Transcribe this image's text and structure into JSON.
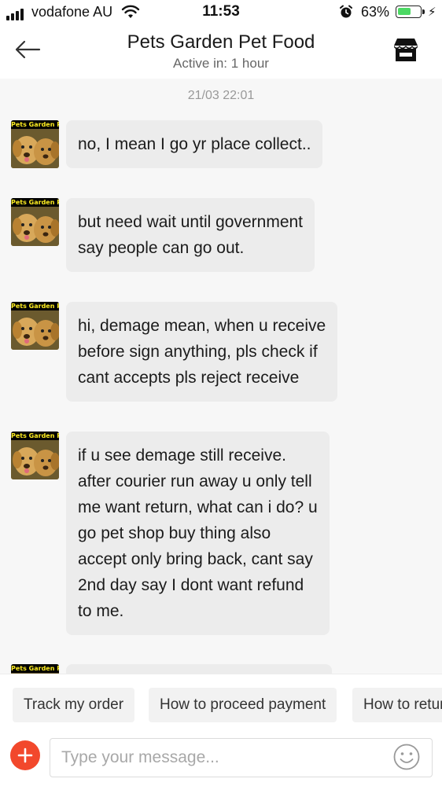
{
  "status_bar": {
    "carrier": "vodafone AU",
    "time": "11:53",
    "battery_percent": "63%",
    "battery_level": 0.63,
    "battery_color": "#4cd964"
  },
  "header": {
    "back_icon": "arrow-left-icon",
    "shop_name": "Pets Garden Pet Food",
    "active_status": "Active in: 1 hour",
    "store_icon": "store-icon"
  },
  "chat": {
    "timestamp": "21/03 22:01",
    "avatar_label": "Pets Garden Pet Food",
    "messages": [
      {
        "text": "no, I mean I go yr place collect.."
      },
      {
        "text": "but need wait until government\nsay people can go out."
      },
      {
        "text": "hi, demage mean, when u receive\nbefore sign anything,  pls check if\ncant accepts pls reject receive"
      },
      {
        "text": "if u see demage still receive.\nafter courier run away u only tell\nme want return, what can i do? u\ngo pet shop buy thing also\naccept only bring back, cant say\n2nd day say I dont want refund\nto me."
      },
      {
        "text": ""
      }
    ]
  },
  "quick_replies": [
    "Track my order",
    "How to proceed payment",
    "How to return"
  ],
  "input": {
    "placeholder": "Type your message...",
    "plus_icon": "plus-icon",
    "emoji_icon": "smiley-icon",
    "accent_color": "#f2482c"
  }
}
